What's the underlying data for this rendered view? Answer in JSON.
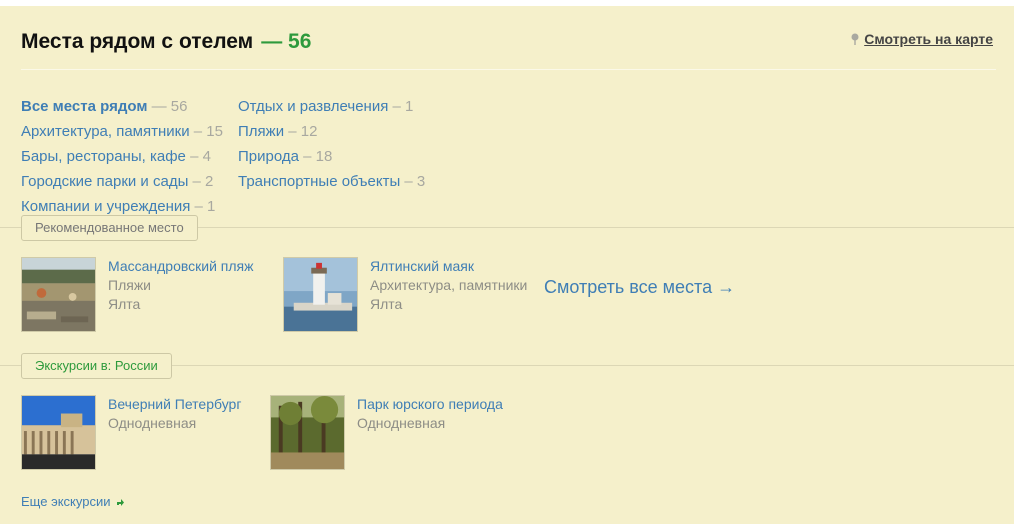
{
  "header": {
    "title": "Места рядом с отелем",
    "count": "— 56",
    "map_link": "Смотреть на карте"
  },
  "categories": {
    "col1": [
      {
        "label": "Все места рядом",
        "count": "— 56",
        "active": true
      },
      {
        "label": "Архитектура, памятники",
        "count": "– 15"
      },
      {
        "label": "Бары, рестораны, кафе",
        "count": "– 4"
      },
      {
        "label": "Городские парки и сады",
        "count": "– 2"
      },
      {
        "label": "Компании и учреждения",
        "count": "– 1"
      }
    ],
    "col2": [
      {
        "label": "Отдых и развлечения",
        "count": "– 1"
      },
      {
        "label": "Пляжи",
        "count": "– 12"
      },
      {
        "label": "Природа",
        "count": "– 18"
      },
      {
        "label": "Транспортные объекты",
        "count": "– 3"
      }
    ]
  },
  "recommended": {
    "tag": "Рекомендованное место",
    "items": [
      {
        "name": "Массандровский пляж",
        "category": "Пляжи",
        "city": "Ялта"
      },
      {
        "name": "Ялтинский маяк",
        "category": "Архитектура, памятники",
        "city": "Ялта"
      }
    ],
    "see_all": "Смотреть все места →"
  },
  "excursions": {
    "tag": "Экскурсии в: России",
    "items": [
      {
        "name": "Вечерний Петербург",
        "duration": "Однодневная"
      },
      {
        "name": "Парк юрского периода",
        "duration": "Однодневная"
      }
    ],
    "more": "Еще экскурсии"
  },
  "colors": {
    "background": "#f5f0cb",
    "link": "#3f7eb5",
    "accent_green": "#2e9a3c",
    "muted": "#8d8d86"
  }
}
